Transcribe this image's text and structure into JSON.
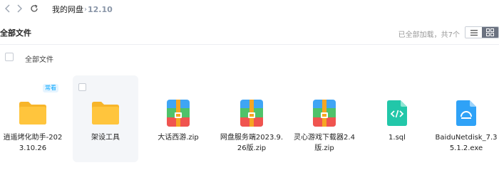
{
  "nav": {
    "back_icon": "chevron-left-icon",
    "forward_icon": "chevron-right-icon",
    "refresh_icon": "refresh-icon"
  },
  "breadcrumb": {
    "root": "我的网盘",
    "separator": "›",
    "current": "12.10"
  },
  "header": {
    "title": "全部文件",
    "status": "已全部加载，共7个",
    "list_view_icon": "list-view-icon",
    "grid_view_icon": "grid-view-icon"
  },
  "select_all": {
    "label": "全部文件"
  },
  "colors": {
    "accent": "#06a7ff",
    "folder": "#ffc53d",
    "archive_blue": "#3fa5f5",
    "archive_green": "#4fc26a",
    "archive_red": "#f0544f",
    "archive_zipper": "#f6a623",
    "sql": "#22c7a9",
    "exe": "#2fa2f7"
  },
  "files": [
    {
      "name": "逍遥烤化助手-2023.10.26",
      "type": "folder",
      "icon": "folder-icon",
      "badge": "常看"
    },
    {
      "name": "架设工具",
      "type": "folder",
      "icon": "folder-icon",
      "hovered": true
    },
    {
      "name": "大话西游.zip",
      "type": "archive",
      "icon": "zip-archive-icon"
    },
    {
      "name": "网盘服务端2023.9.26版.zip",
      "type": "archive",
      "icon": "zip-archive-icon"
    },
    {
      "name": "灵心游戏下载器2.4版.zip",
      "type": "archive",
      "icon": "zip-archive-icon"
    },
    {
      "name": "1.sql",
      "type": "code",
      "icon": "code-file-icon"
    },
    {
      "name": "BaiduNetdisk_7.35.1.2.exe",
      "type": "exe",
      "icon": "exe-file-icon"
    }
  ]
}
